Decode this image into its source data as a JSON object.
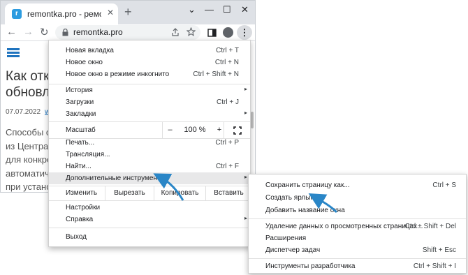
{
  "browser": {
    "tab_title": "remontka.pro - ремонт компьютеров",
    "tab_close": "✕",
    "new_tab": "+",
    "window_controls": [
      "⌄",
      "—",
      "☐",
      "✕"
    ],
    "url": "remontka.pro",
    "nav": {
      "back": "←",
      "forward": "→",
      "reload": "↻"
    },
    "menu_button": "⋮"
  },
  "page": {
    "title_lines": [
      "Как отключить",
      "обновле"
    ],
    "date": "07.07.2022",
    "category_link": "windows",
    "body_lines": [
      "Способы о",
      "из Центра",
      "для конкре",
      "автоматиче",
      "при устано"
    ]
  },
  "menu": {
    "items_top": [
      {
        "label": "Новая вкладка",
        "shortcut": "Ctrl + T"
      },
      {
        "label": "Новое окно",
        "shortcut": "Ctrl + N"
      },
      {
        "label": "Новое окно в режиме инкогнито",
        "shortcut": "Ctrl + Shift + N"
      }
    ],
    "items_history": [
      {
        "label": "История",
        "shortcut": "",
        "submenu": true
      },
      {
        "label": "Загрузки",
        "shortcut": "Ctrl + J",
        "submenu": false
      },
      {
        "label": "Закладки",
        "shortcut": "",
        "submenu": true
      }
    ],
    "zoom": {
      "label": "Масштаб",
      "minus": "–",
      "value": "100 %",
      "plus": "+"
    },
    "items_tools": [
      {
        "label": "Печать...",
        "shortcut": "Ctrl + P",
        "submenu": false
      },
      {
        "label": "Трансляция...",
        "shortcut": "",
        "submenu": false
      },
      {
        "label": "Найти...",
        "shortcut": "Ctrl + F",
        "submenu": false
      },
      {
        "label": "Дополнительные инструменты",
        "shortcut": "",
        "submenu": true
      }
    ],
    "edit": {
      "label": "Изменить",
      "cut": "Вырезать",
      "copy": "Копировать",
      "paste": "Вставить"
    },
    "items_settings": [
      {
        "label": "Настройки",
        "submenu": false
      },
      {
        "label": "Справка",
        "submenu": true
      }
    ],
    "exit": "Выход",
    "submenu_arrow": "▸"
  },
  "submenu": {
    "items_a": [
      {
        "label": "Сохранить страницу как...",
        "shortcut": "Ctrl + S"
      },
      {
        "label": "Создать ярлык...",
        "shortcut": ""
      },
      {
        "label": "Добавить название окна",
        "shortcut": ""
      }
    ],
    "items_b": [
      {
        "label": "Удаление данных о просмотренных страницах...",
        "shortcut": "Ctrl + Shift + Del"
      },
      {
        "label": "Расширения",
        "shortcut": ""
      },
      {
        "label": "Диспетчер задач",
        "shortcut": "Shift + Esc"
      }
    ],
    "items_c": [
      {
        "label": "Инструменты разработчика",
        "shortcut": "Ctrl + Shift + I"
      }
    ]
  },
  "colors": {
    "accent": "#1e73be",
    "annotation_arrow": "#2a86c7",
    "highlight": "#e8e8e9"
  }
}
